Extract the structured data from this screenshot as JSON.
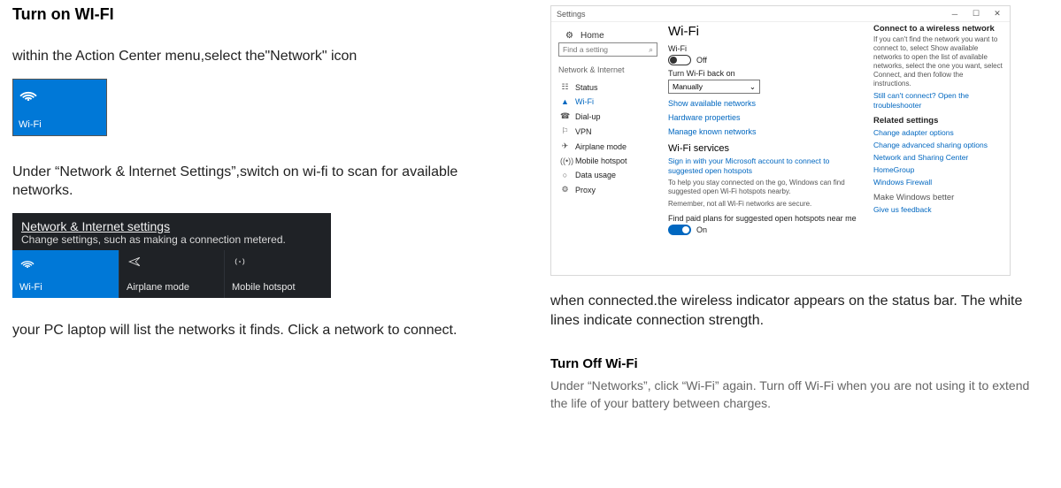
{
  "left": {
    "title": "Turn on WI-FI",
    "p1": "within the Action Center menu,select the\"Network\" icon",
    "tile_label": "Wi-Fi",
    "p2": "Under “Network & lnternet Settings”,switch on wi-fi to scan for available networks.",
    "netpanel": {
      "title": "Network & Internet settings",
      "sub": "Change settings, such as making a connection metered.",
      "cells": [
        "Wi-Fi",
        "Airplane mode",
        "Mobile hotspot"
      ]
    },
    "p3": "your PC laptop will list the networks it finds. Click a network to connect."
  },
  "settings": {
    "win_title": "Settings",
    "home": "Home",
    "search_placeholder": "Find a setting",
    "section": "Network & Internet",
    "side_items": [
      {
        "icon": "☷",
        "label": "Status"
      },
      {
        "icon": "▲",
        "label": "Wi-Fi",
        "active": true
      },
      {
        "icon": "☎",
        "label": "Dial-up"
      },
      {
        "icon": "⚐",
        "label": "VPN"
      },
      {
        "icon": "✈",
        "label": "Airplane mode"
      },
      {
        "icon": "((•))",
        "label": "Mobile hotspot"
      },
      {
        "icon": "○",
        "label": "Data usage"
      },
      {
        "icon": "⚙",
        "label": "Proxy"
      }
    ],
    "main": {
      "h1": "Wi-Fi",
      "wifi_label": "Wi-Fi",
      "off": "Off",
      "turn_back": "Turn Wi-Fi back on",
      "select_value": "Manually",
      "links1": [
        "Show available networks",
        "Hardware properties",
        "Manage known networks"
      ],
      "services_h": "Wi-Fi services",
      "signin": "Sign in with your Microsoft account to connect to suggested open hotspots",
      "help": "To help you stay connected on the go, Windows can find suggested open Wi-Fi hotspots nearby.",
      "remember": "Remember, not all Wi-Fi networks are secure.",
      "find_paid": "Find paid plans for suggested open hotspots near me",
      "on": "On"
    },
    "rightcol": {
      "connect_h": "Connect to a wireless network",
      "connect_body": "If you can't find the network you want to connect to, select Show available networks to open the list of available networks, select the one you want, select Connect, and then follow the instructions.",
      "troubleshoot": "Still can't connect? Open the troubleshooter",
      "related_h": "Related settings",
      "related": [
        "Change adapter options",
        "Change advanced sharing options",
        "Network and Sharing Center",
        "HomeGroup",
        "Windows Firewall"
      ],
      "make_better": "Make Windows better",
      "feedback": "Give us feedback"
    }
  },
  "right_text": {
    "p1": "when connected.the wireless indicator appears on the status bar. The white lines indicate connection strength.",
    "off_h": "Turn Off Wi-Fi",
    "off_body": "Under “Networks”, click “Wi-Fi” again. Turn off Wi-Fi when you are not using it to extend the life of your battery between charges."
  }
}
